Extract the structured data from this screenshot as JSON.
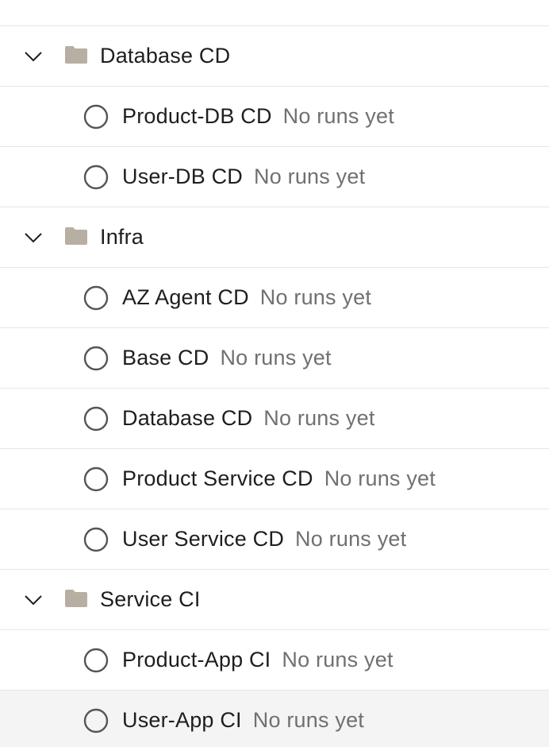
{
  "groups": [
    {
      "name": "Database CD",
      "items": [
        {
          "name": "Product-DB CD",
          "status": "No runs yet"
        },
        {
          "name": "User-DB CD",
          "status": "No runs yet"
        }
      ]
    },
    {
      "name": "Infra",
      "items": [
        {
          "name": "AZ Agent CD",
          "status": "No runs yet"
        },
        {
          "name": "Base CD",
          "status": "No runs yet"
        },
        {
          "name": "Database CD",
          "status": "No runs yet"
        },
        {
          "name": "Product Service CD",
          "status": "No runs yet"
        },
        {
          "name": "User Service CD",
          "status": "No runs yet"
        }
      ]
    },
    {
      "name": "Service CI",
      "items": [
        {
          "name": "Product-App CI",
          "status": "No runs yet"
        },
        {
          "name": "User-App CI",
          "status": "No runs yet"
        }
      ]
    }
  ],
  "icons": {
    "expand": "chevron-down-icon",
    "folder": "folder-icon",
    "status": "circle-outline-icon"
  },
  "colors": {
    "text": "#1e1e1e",
    "muted": "#707070",
    "folder": "#b8afa3",
    "divider": "#e6e6e6",
    "hover_row": "#f4f4f4"
  }
}
